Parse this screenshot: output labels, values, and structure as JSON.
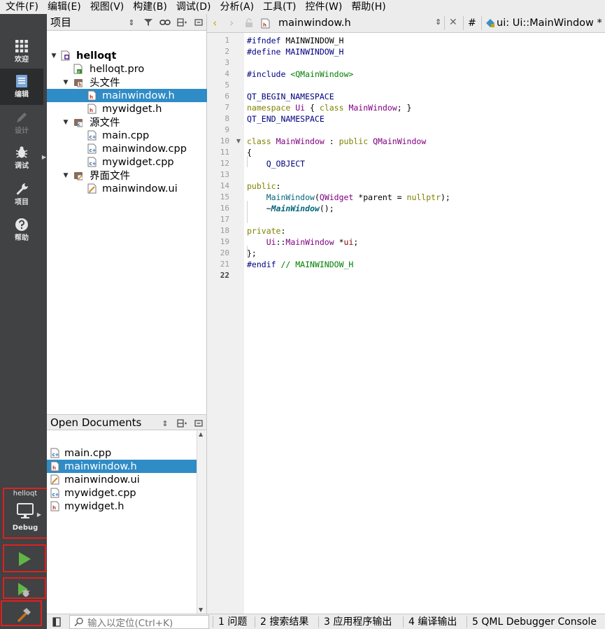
{
  "menubar": {
    "items": [
      "文件(F)",
      "编辑(E)",
      "视图(V)",
      "构建(B)",
      "调试(D)",
      "分析(A)",
      "工具(T)",
      "控件(W)",
      "帮助(H)"
    ]
  },
  "modes": {
    "welcome": "欢迎",
    "edit": "编辑",
    "design": "设计",
    "debug": "调试",
    "projects": "项目",
    "help": "帮助"
  },
  "kit": {
    "project": "helloqt",
    "config": "Debug"
  },
  "annotations": [
    "1",
    "2",
    "3",
    "4"
  ],
  "project_panel": {
    "title": "项目",
    "tree": [
      {
        "label": "helloqt",
        "level": 0,
        "type": "project",
        "expanded": true,
        "bold": true
      },
      {
        "label": "helloqt.pro",
        "level": 1,
        "type": "pro"
      },
      {
        "label": "头文件",
        "level": 1,
        "type": "folder-h",
        "expanded": true
      },
      {
        "label": "mainwindow.h",
        "level": 2,
        "type": "header",
        "selected": true
      },
      {
        "label": "mywidget.h",
        "level": 2,
        "type": "header"
      },
      {
        "label": "源文件",
        "level": 1,
        "type": "folder-cpp",
        "expanded": true
      },
      {
        "label": "main.cpp",
        "level": 2,
        "type": "source"
      },
      {
        "label": "mainwindow.cpp",
        "level": 2,
        "type": "source"
      },
      {
        "label": "mywidget.cpp",
        "level": 2,
        "type": "source"
      },
      {
        "label": "界面文件",
        "level": 1,
        "type": "folder-ui",
        "expanded": true
      },
      {
        "label": "mainwindow.ui",
        "level": 2,
        "type": "form"
      }
    ]
  },
  "open_documents": {
    "title": "Open Documents",
    "items": [
      {
        "label": "main.cpp",
        "type": "source"
      },
      {
        "label": "mainwindow.h",
        "type": "header",
        "selected": true
      },
      {
        "label": "mainwindow.ui",
        "type": "form"
      },
      {
        "label": "mywidget.cpp",
        "type": "source"
      },
      {
        "label": "mywidget.h",
        "type": "header"
      }
    ]
  },
  "editor": {
    "file_name": "mainwindow.h",
    "hash": "#",
    "symbol": "ui: Ui::MainWindow *",
    "current_line": 22,
    "lines": [
      [
        [
          "pp",
          "#ifndef"
        ],
        [
          "id",
          " MAINWINDOW_H"
        ]
      ],
      [
        [
          "pp",
          "#define"
        ],
        [
          "mac",
          " MAINWINDOW_H"
        ]
      ],
      [],
      [
        [
          "pp",
          "#include"
        ],
        [
          "id",
          " "
        ],
        [
          "str",
          "<QMainWindow>"
        ]
      ],
      [],
      [
        [
          "mac",
          "QT_BEGIN_NAMESPACE"
        ]
      ],
      [
        [
          "kw",
          "namespace"
        ],
        [
          "id",
          " "
        ],
        [
          "type",
          "Ui"
        ],
        [
          "id",
          " { "
        ],
        [
          "kw",
          "class"
        ],
        [
          "id",
          " "
        ],
        [
          "type",
          "MainWindow"
        ],
        [
          "id",
          "; }"
        ]
      ],
      [
        [
          "mac",
          "QT_END_NAMESPACE"
        ]
      ],
      [],
      [
        [
          "kw",
          "class"
        ],
        [
          "id",
          " "
        ],
        [
          "type",
          "MainWindow"
        ],
        [
          "id",
          " : "
        ],
        [
          "kw",
          "public"
        ],
        [
          "id",
          " "
        ],
        [
          "type",
          "QMainWindow"
        ]
      ],
      [
        [
          "id",
          "{"
        ]
      ],
      [
        [
          "id",
          "    "
        ],
        [
          "mac",
          "Q_OBJECT"
        ]
      ],
      [],
      [
        [
          "kw",
          "public"
        ],
        [
          "id",
          ":"
        ]
      ],
      [
        [
          "id",
          "    "
        ],
        [
          "fn",
          "MainWindow"
        ],
        [
          "id",
          "("
        ],
        [
          "type",
          "QWidget"
        ],
        [
          "id",
          " *parent = "
        ],
        [
          "kw",
          "nullptr"
        ],
        [
          "id",
          ");"
        ]
      ],
      [
        [
          "id",
          "    ~"
        ],
        [
          "fnb",
          "MainWindow"
        ],
        [
          "id",
          "();"
        ]
      ],
      [],
      [
        [
          "kw",
          "private"
        ],
        [
          "id",
          ":"
        ]
      ],
      [
        [
          "id",
          "    "
        ],
        [
          "type",
          "Ui"
        ],
        [
          "id",
          "::"
        ],
        [
          "type",
          "MainWindow"
        ],
        [
          "id",
          " *"
        ],
        [
          "member",
          "ui"
        ],
        [
          "id",
          ";"
        ]
      ],
      [
        [
          "id",
          "};"
        ]
      ],
      [
        [
          "pp",
          "#endif"
        ],
        [
          "id",
          " "
        ],
        [
          "cm",
          "// MAINWINDOW_H"
        ]
      ],
      []
    ]
  },
  "statusbar": {
    "locator_placeholder": "输入以定位(Ctrl+K)",
    "tabs": [
      "1 问题",
      "2 搜索结果",
      "3 应用程序输出",
      "4 编译输出",
      "5 QML Debugger Console"
    ]
  }
}
